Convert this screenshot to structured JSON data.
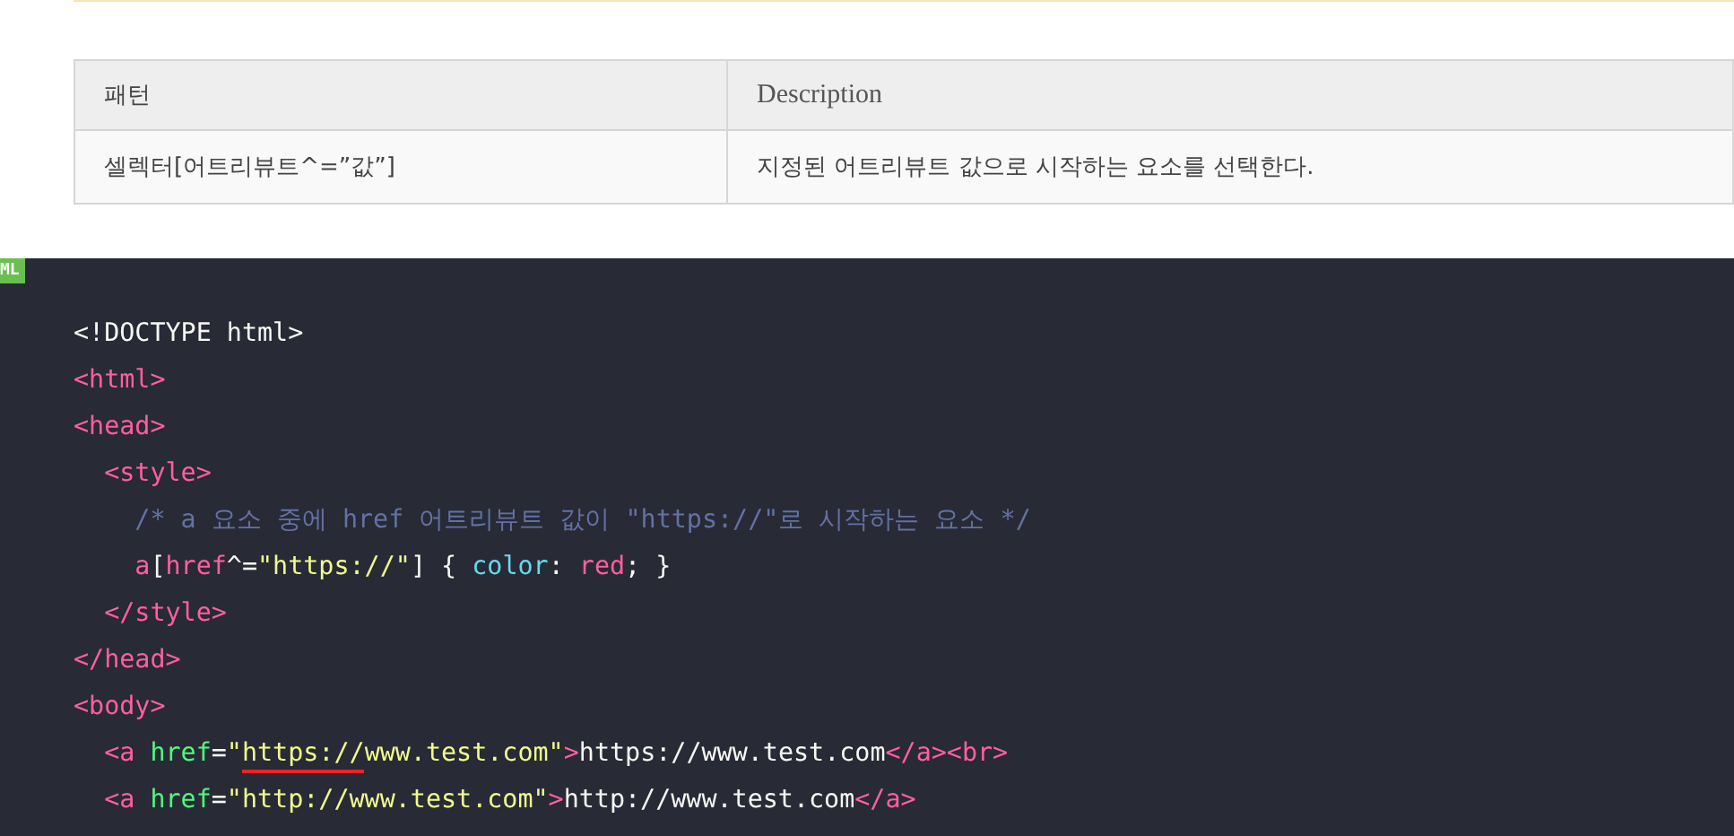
{
  "table": {
    "columns": [
      "패턴",
      "Description"
    ],
    "rows": [
      [
        "셀렉터[어트리뷰트^=”값”]",
        "지정된 어트리뷰트 값으로 시작하는 요소를 선택한다."
      ]
    ]
  },
  "code_block": {
    "language_badge": "ML",
    "lines": [
      {
        "tokens": [
          {
            "kind": "plain",
            "text": "<!DOCTYPE html>"
          }
        ]
      },
      {
        "tokens": [
          {
            "kind": "tag",
            "text": "<html>"
          }
        ]
      },
      {
        "tokens": [
          {
            "kind": "tag",
            "text": "<head>"
          }
        ],
        "children": [
          {
            "tokens": [
              {
                "kind": "tag",
                "text": "<style>"
              }
            ],
            "children": [
              {
                "tokens": [
                  {
                    "kind": "comment",
                    "text": "/* a 요소 중에 href 어트리뷰트 값이 \"https://\"로 시작하는 요소 */"
                  }
                ]
              },
              {
                "tokens": [
                  {
                    "kind": "tag",
                    "text": "a"
                  },
                  {
                    "kind": "plain",
                    "text": "["
                  },
                  {
                    "kind": "tag",
                    "text": "href"
                  },
                  {
                    "kind": "plain",
                    "text": "^="
                  },
                  {
                    "kind": "string",
                    "text": "\"https://\""
                  },
                  {
                    "kind": "plain",
                    "text": "] { "
                  },
                  {
                    "kind": "prop",
                    "text": "color"
                  },
                  {
                    "kind": "plain",
                    "text": ": "
                  },
                  {
                    "kind": "tag",
                    "text": "red"
                  },
                  {
                    "kind": "plain",
                    "text": "; }"
                  }
                ]
              }
            ]
          },
          {
            "tokens": [
              {
                "kind": "tag",
                "text": "</style>"
              }
            ]
          }
        ]
      },
      {
        "tokens": [
          {
            "kind": "tag",
            "text": "</head>"
          }
        ]
      },
      {
        "tokens": [
          {
            "kind": "tag",
            "text": "<body>"
          }
        ],
        "children": [
          {
            "tokens": [
              {
                "kind": "tag",
                "text": "<a "
              },
              {
                "kind": "attr",
                "text": "href"
              },
              {
                "kind": "plain",
                "text": "="
              },
              {
                "kind": "string",
                "text": "\""
              },
              {
                "kind": "string-underlined",
                "text": "https://"
              },
              {
                "kind": "string",
                "text": "www.test.com\""
              },
              {
                "kind": "tag",
                "text": ">"
              },
              {
                "kind": "plain",
                "text": "https://www.test.com"
              },
              {
                "kind": "tag",
                "text": "</a><br>"
              }
            ]
          },
          {
            "tokens": [
              {
                "kind": "tag",
                "text": "<a "
              },
              {
                "kind": "attr",
                "text": "href"
              },
              {
                "kind": "plain",
                "text": "="
              },
              {
                "kind": "string",
                "text": "\"http://www.test.com\""
              },
              {
                "kind": "tag",
                "text": ">"
              },
              {
                "kind": "plain",
                "text": "http://www.test.com"
              },
              {
                "kind": "tag",
                "text": "</a>"
              }
            ]
          }
        ]
      }
    ]
  }
}
